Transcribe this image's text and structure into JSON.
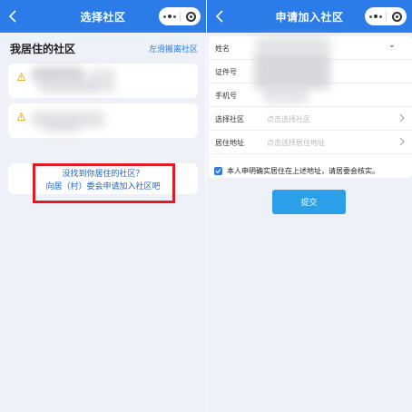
{
  "left": {
    "nav": {
      "title": "选择社区",
      "back_icon": "chevron-left-icon"
    },
    "section_title": "我居住的社区",
    "swipe_hint": "左滑搬离社区",
    "community_cards": [
      {
        "icon": "warning-icon"
      },
      {
        "icon": "warning-icon"
      }
    ],
    "tip": {
      "line1": "没找到你居住的社区？",
      "line2": "向居（村）委会申请加入社区吧"
    }
  },
  "right": {
    "nav": {
      "title": "申请加入社区",
      "back_icon": "chevron-left-icon"
    },
    "fields": [
      {
        "label": "姓名",
        "placeholder": ""
      },
      {
        "label": "证件号",
        "placeholder": ""
      },
      {
        "label": "手机号",
        "placeholder": ""
      },
      {
        "label": "选择社区",
        "placeholder": "点击选择社区"
      },
      {
        "label": "居住地址",
        "placeholder": "点击选择居住地址"
      }
    ],
    "confirm_text": "本人申明确实居住在上述地址，请居委会核实。",
    "submit_label": "提交"
  },
  "colors": {
    "nav_bg": "#2b7be8",
    "page_bg": "#eef1f7",
    "link": "#1f63c7",
    "highlight": "#e01b24",
    "submit": "#2b9fe8",
    "warning": "#e8b730"
  }
}
